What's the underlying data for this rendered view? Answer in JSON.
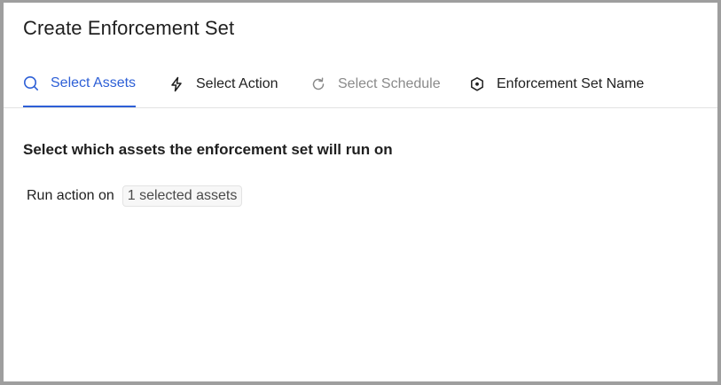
{
  "dialog": {
    "title": "Create Enforcement Set"
  },
  "tabs": [
    {
      "label": "Select Assets",
      "icon": "search-icon",
      "state": "active"
    },
    {
      "label": "Select Action",
      "icon": "lightning-icon",
      "state": "normal"
    },
    {
      "label": "Select Schedule",
      "icon": "refresh-icon",
      "state": "disabled"
    },
    {
      "label": "Enforcement Set Name",
      "icon": "shield-icon",
      "state": "normal"
    }
  ],
  "content": {
    "heading": "Select which assets the enforcement set will run on",
    "run_label": "Run action on",
    "selected_assets": "1 selected assets"
  },
  "colors": {
    "accent": "#2d5fd6",
    "disabled": "#8a8a8a",
    "text": "#1f1f1f",
    "border": "#e3e3e3"
  }
}
